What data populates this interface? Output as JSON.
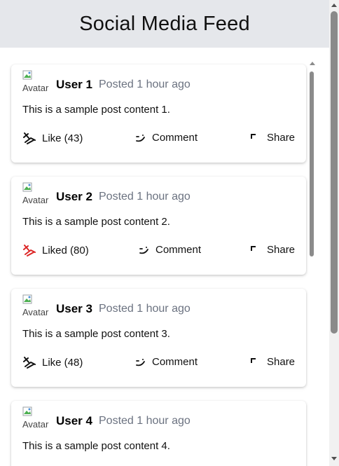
{
  "header": {
    "title": "Social Media Feed"
  },
  "posts": [
    {
      "avatar_alt": "Avatar",
      "username": "User 1",
      "timestamp": "Posted 1 hour ago",
      "content": "This is a sample post content 1.",
      "like_label": "Like (43)",
      "liked": false,
      "comment_label": "Comment",
      "share_label": "Share"
    },
    {
      "avatar_alt": "Avatar",
      "username": "User 2",
      "timestamp": "Posted 1 hour ago",
      "content": "This is a sample post content 2.",
      "like_label": "Liked (80)",
      "liked": true,
      "comment_label": "Comment",
      "share_label": "Share"
    },
    {
      "avatar_alt": "Avatar",
      "username": "User 3",
      "timestamp": "Posted 1 hour ago",
      "content": "This is a sample post content 3.",
      "like_label": "Like (48)",
      "liked": false,
      "comment_label": "Comment",
      "share_label": "Share"
    },
    {
      "avatar_alt": "Avatar",
      "username": "User 4",
      "timestamp": "Posted 1 hour ago",
      "content": "This is a sample post content 4."
    }
  ],
  "colors": {
    "header_bg": "#e5e7eb",
    "liked": "#dc2626",
    "timestamp": "#6b7280"
  },
  "icons": {
    "like": "thumbs-up-icon",
    "liked": "thumbs-up-filled-icon",
    "comment": "comment-icon",
    "share": "share-icon"
  }
}
